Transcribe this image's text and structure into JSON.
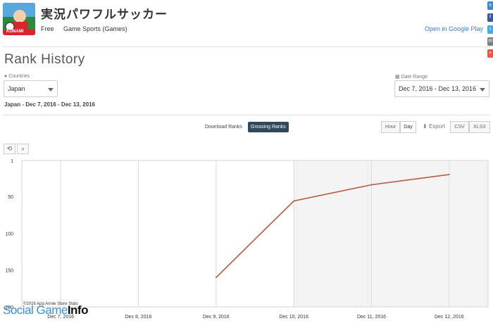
{
  "app": {
    "title": "実況パワフルサッカー",
    "price": "Free",
    "category": "Game Sports (Games)",
    "open_link": "Open in Google Play",
    "icon_label": "KONAMI"
  },
  "page": {
    "title": "Rank History",
    "countries_label": "Countries",
    "country_value": "Japan",
    "date_range_label": "Date Range",
    "date_range_value": "Dec 7, 2016 - Dec 13, 2016",
    "subtitle": "Japan - Dec 7, 2016 - Dec 13, 2016"
  },
  "controls": {
    "download_ranks": "Download Ranks",
    "grossing_ranks": "Grossing Ranks",
    "hour": "Hour",
    "day": "Day",
    "export": "Export",
    "csv": "CSV",
    "xlsx": "XLSX"
  },
  "colors": {
    "line": "#b9583a",
    "active_toggle": "#2f4a5d",
    "link": "#3a7bbf"
  },
  "chart_data": {
    "type": "line",
    "y_reversed": true,
    "ylim": [
      1,
      200
    ],
    "yticks": [
      "1",
      "50",
      "100",
      "150",
      "200"
    ],
    "ytick_values": [
      1,
      50,
      100,
      150,
      200
    ],
    "categories": [
      "Dec 7, 2016",
      "Dec 8, 2016",
      "Dec 9, 2016",
      "Dec 10, 2016",
      "Dec 11, 2016",
      "Dec 12, 2016"
    ],
    "series": [
      {
        "values": [
          null,
          null,
          160,
          56,
          34,
          20
        ]
      }
    ],
    "shaded_from": "Dec 10, 2016",
    "credit": "©2016 App Annie Store Stats"
  },
  "watermark": {
    "part1": "Social Game",
    "part2": "Info"
  }
}
